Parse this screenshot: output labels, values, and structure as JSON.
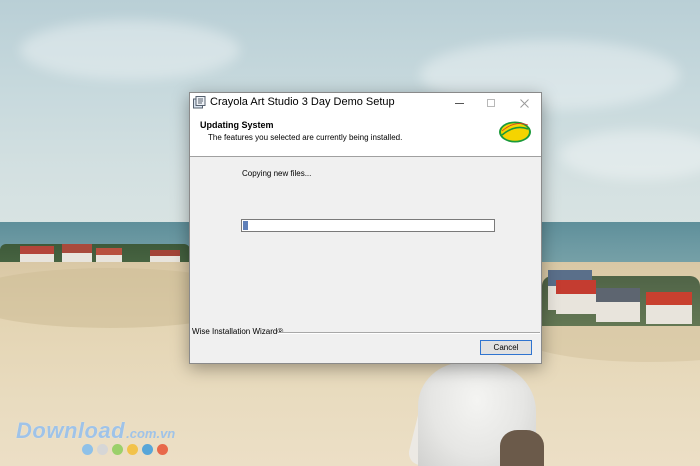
{
  "window": {
    "title": "Crayola Art Studio 3 Day Demo Setup",
    "header_title": "Updating System",
    "header_description": "The features you selected are currently being installed.",
    "status_text": "Copying new files...",
    "progress": 0.02,
    "branding": "Wise Installation Wizard®",
    "cancel_label": "Cancel",
    "logo_text": "Crayola"
  },
  "watermark": {
    "main": "Download",
    "suffix": ".com.vn",
    "dot_colors": [
      "#8fc1e8",
      "#d6d6d6",
      "#9bd06a",
      "#f2c24a",
      "#58a6d8",
      "#e8684a"
    ]
  },
  "colors": {
    "progress_fill": "#5f7fb8",
    "focus_border": "#2f74d0",
    "logo_yellow": "#f5d400",
    "logo_green": "#1a9a3a"
  },
  "icons": {
    "app": "installer-icon",
    "minimize": "minimize-icon",
    "maximize": "maximize-icon",
    "close": "close-icon"
  }
}
